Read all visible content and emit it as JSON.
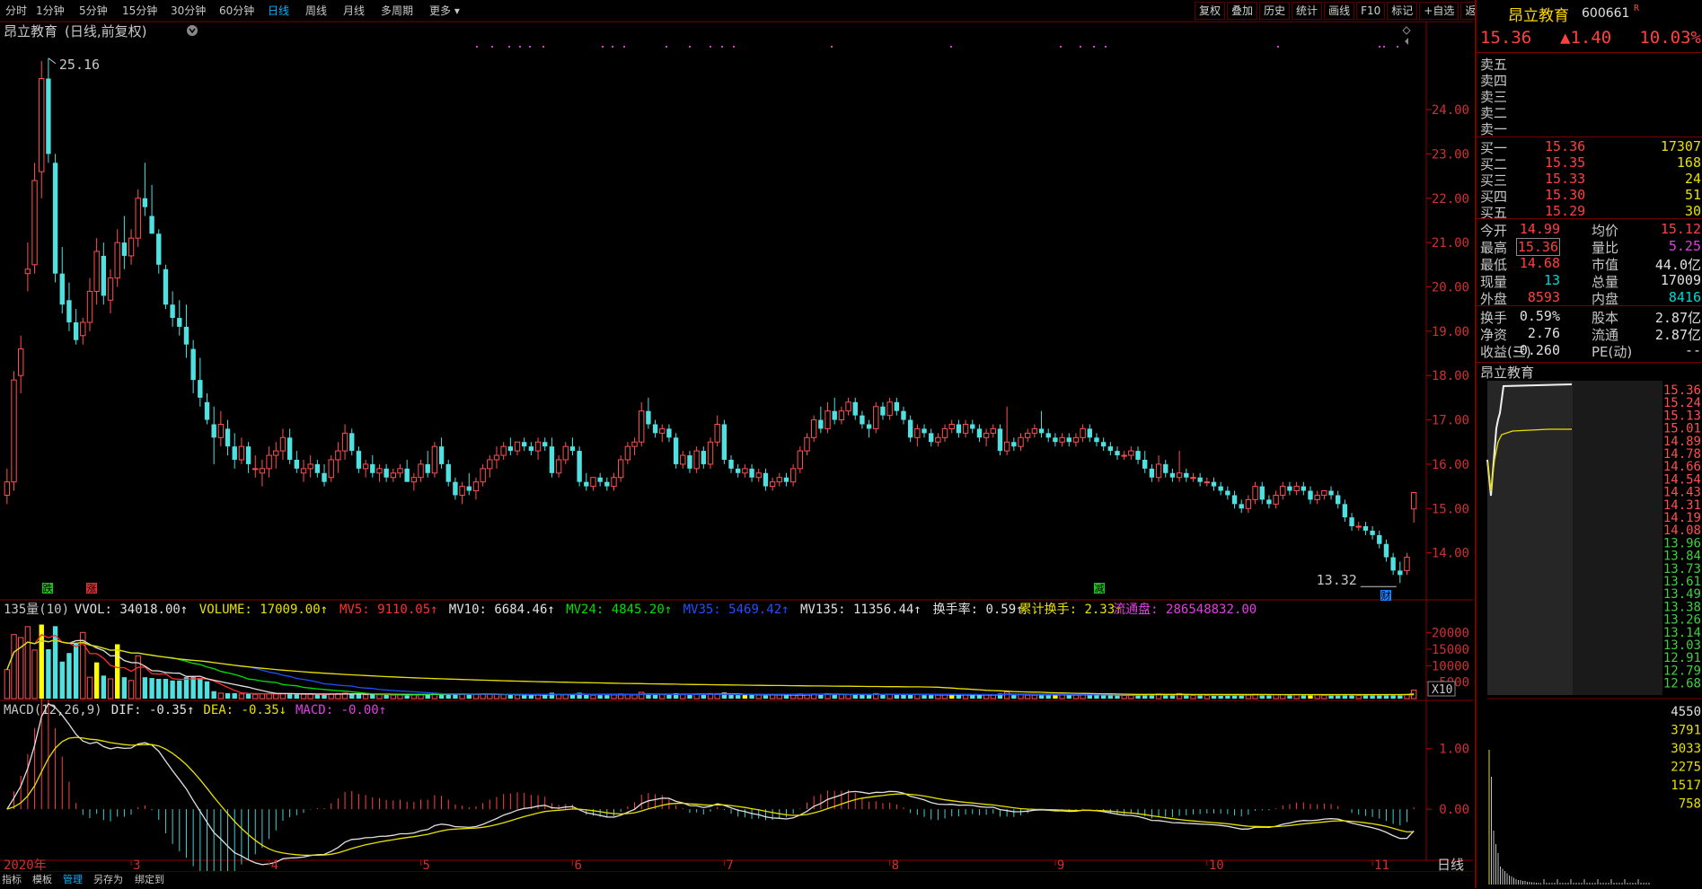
{
  "toolbar": {
    "periods": [
      "分时",
      "1分钟",
      "5分钟",
      "15分钟",
      "30分钟",
      "60分钟",
      "日线",
      "周线",
      "月线",
      "多周期",
      "更多"
    ],
    "active_period": "日线",
    "right_tools": [
      "复权",
      "叠加",
      "历史",
      "统计",
      "画线",
      "F10",
      "标记",
      "+自选",
      "返回"
    ]
  },
  "chart_header": {
    "title": "昂立教育",
    "subtitle": "(日线,前复权)",
    "high_label": "25.16",
    "low_label": "13.32",
    "markers": {
      "die": "跌",
      "zhang": "涨",
      "jian": "减",
      "cai": "财"
    }
  },
  "price_axis": {
    "labels": [
      "24.00",
      "23.00",
      "22.00",
      "21.00",
      "20.00",
      "19.00",
      "18.00",
      "17.00",
      "16.00",
      "15.00",
      "14.00"
    ]
  },
  "volume_header": {
    "items": [
      {
        "text": "135量(10)",
        "color": "#c8c8c8"
      },
      {
        "text": "VVOL: 34018.00↑",
        "color": "#e0e0e0"
      },
      {
        "text": "VOLUME: 17009.00↑",
        "color": "#e8e000"
      },
      {
        "text": "MV5: 9110.05↑",
        "color": "#ff3030"
      },
      {
        "text": "MV10: 6684.46↑",
        "color": "#e0e0e0"
      },
      {
        "text": "MV24: 4845.20↑",
        "color": "#00e000"
      },
      {
        "text": "MV35: 5469.42↑",
        "color": "#2050ff"
      },
      {
        "text": "MV135: 11356.44↑",
        "color": "#e0e0e0"
      },
      {
        "text": "换手率: 0.59↑",
        "color": "#e0e0e0"
      },
      {
        "text": "累计换手: 2.33↑",
        "color": "#e8e000"
      },
      {
        "text": "流通盘: 286548832.00",
        "color": "#e040e0"
      }
    ],
    "axis_labels": [
      "20000",
      "15000",
      "10000",
      "5000"
    ],
    "multiplier": "X10"
  },
  "macd_header": {
    "items": [
      {
        "text": "MACD(12,26,9)",
        "color": "#c8c8c8"
      },
      {
        "text": "DIF: -0.35↑",
        "color": "#e0e0e0"
      },
      {
        "text": "DEA: -0.35↓",
        "color": "#e8e000"
      },
      {
        "text": "MACD: -0.00↑",
        "color": "#e040e0"
      }
    ],
    "axis_labels": [
      "1.00",
      "0.00"
    ]
  },
  "time_axis": {
    "labels": [
      "2020年",
      "3",
      "4",
      "5",
      "6",
      "7",
      "8",
      "9",
      "10",
      "11"
    ],
    "period_label": "日线"
  },
  "bottom_tabs": {
    "items": [
      "指标",
      "模板",
      "管理",
      "另存为",
      "绑定到"
    ],
    "active": "管理"
  },
  "quote": {
    "name": "昂立教育",
    "code": "600661",
    "badge": "R",
    "price": "15.36",
    "change": "▲1.40",
    "change_pct": "10.03%",
    "sell_levels": [
      "卖五",
      "卖四",
      "卖三",
      "卖二",
      "卖一"
    ],
    "buy_levels": [
      {
        "label": "买一",
        "price": "15.36",
        "vol": "17307"
      },
      {
        "label": "买二",
        "price": "15.35",
        "vol": "168"
      },
      {
        "label": "买三",
        "price": "15.33",
        "vol": "24"
      },
      {
        "label": "买四",
        "price": "15.30",
        "vol": "51"
      },
      {
        "label": "买五",
        "price": "15.29",
        "vol": "30"
      }
    ],
    "stats": [
      {
        "l1": "今开",
        "v1": "14.99",
        "c1": "red",
        "l2": "均价",
        "v2": "15.12",
        "c2": "red"
      },
      {
        "l1": "最高",
        "v1": "15.36",
        "c1": "red",
        "l2": "量比",
        "v2": "5.25",
        "c2": "magenta"
      },
      {
        "l1": "最低",
        "v1": "14.68",
        "c1": "red",
        "l2": "市值",
        "v2": "44.0亿",
        "c2": "white"
      },
      {
        "l1": "现量",
        "v1": "13",
        "c1": "cyan",
        "l2": "总量",
        "v2": "17009",
        "c2": "white"
      },
      {
        "l1": "外盘",
        "v1": "8593",
        "c1": "red",
        "l2": "内盘",
        "v2": "8416",
        "c2": "cyan"
      }
    ],
    "stats2": [
      {
        "l1": "换手",
        "v1": "0.59%",
        "l2": "股本",
        "v2": "2.87亿"
      },
      {
        "l1": "净资",
        "v1": "2.76",
        "l2": "流通",
        "v2": "2.87亿"
      },
      {
        "l1": "收益(三)",
        "v1": "-0.260",
        "l2": "PE(动)",
        "v2": "--"
      }
    ],
    "mini_title": "昂立教育",
    "mini_price_labels": [
      "15.36",
      "15.24",
      "15.13",
      "15.01",
      "14.89",
      "14.78",
      "14.66",
      "14.54",
      "14.43",
      "14.31",
      "14.19",
      "14.08",
      "13.96",
      "13.84",
      "13.73",
      "13.61",
      "13.49",
      "13.38",
      "13.26",
      "13.14",
      "13.03",
      "12.91",
      "12.79",
      "12.68"
    ],
    "mini_vol_labels": [
      "4550",
      "3791",
      "3033",
      "2275",
      "1517",
      "758"
    ]
  },
  "chart_data": {
    "type": "candlestick",
    "title": "昂立教育",
    "x_start": "2020年",
    "month_labels": [
      "3",
      "4",
      "5",
      "6",
      "7",
      "8",
      "9",
      "10",
      "11"
    ],
    "ylim": [
      13.0,
      25.5
    ],
    "ohlc": [
      [
        15.3,
        15.9,
        15.1,
        15.6
      ],
      [
        15.6,
        18.1,
        15.4,
        17.9
      ],
      [
        18.0,
        18.9,
        17.6,
        18.6
      ],
      [
        20.3,
        21.0,
        19.9,
        20.4
      ],
      [
        20.5,
        22.8,
        20.3,
        22.4
      ],
      [
        22.6,
        25.1,
        22.0,
        24.7
      ],
      [
        24.7,
        25.16,
        22.8,
        23.0
      ],
      [
        22.8,
        23.0,
        20.1,
        20.3
      ],
      [
        20.3,
        20.9,
        19.4,
        19.6
      ],
      [
        19.7,
        20.1,
        19.0,
        19.2
      ],
      [
        19.2,
        19.5,
        18.7,
        18.8
      ],
      [
        18.9,
        19.3,
        18.7,
        19.2
      ],
      [
        19.2,
        20.2,
        19.0,
        19.9
      ],
      [
        19.9,
        21.1,
        19.6,
        20.8
      ],
      [
        20.7,
        21.0,
        19.6,
        19.8
      ],
      [
        19.7,
        20.4,
        19.4,
        20.2
      ],
      [
        20.2,
        21.3,
        20.0,
        21.0
      ],
      [
        21.0,
        21.6,
        20.4,
        20.7
      ],
      [
        20.7,
        21.3,
        20.5,
        21.1
      ],
      [
        21.1,
        22.2,
        20.9,
        22.0
      ],
      [
        22.0,
        22.8,
        21.6,
        21.8
      ],
      [
        21.6,
        22.3,
        21.2,
        21.2
      ],
      [
        21.2,
        21.3,
        20.3,
        20.5
      ],
      [
        20.4,
        20.5,
        19.5,
        19.6
      ],
      [
        19.6,
        19.9,
        19.1,
        19.3
      ],
      [
        19.3,
        19.7,
        18.9,
        19.1
      ],
      [
        19.1,
        19.6,
        18.4,
        18.7
      ],
      [
        18.6,
        18.8,
        17.6,
        17.9
      ],
      [
        17.9,
        18.4,
        17.3,
        17.5
      ],
      [
        17.4,
        17.6,
        16.9,
        17.0
      ],
      [
        16.9,
        17.3,
        16.0,
        16.6
      ],
      [
        16.6,
        17.2,
        16.4,
        16.9
      ],
      [
        16.8,
        17.0,
        16.2,
        16.4
      ],
      [
        16.4,
        16.7,
        15.9,
        16.1
      ],
      [
        16.1,
        16.6,
        16.0,
        16.4
      ],
      [
        16.4,
        16.5,
        15.8,
        16.0
      ],
      [
        15.9,
        16.2,
        15.7,
        15.9
      ],
      [
        15.8,
        16.1,
        15.5,
        15.9
      ],
      [
        15.9,
        16.4,
        15.7,
        16.2
      ],
      [
        16.2,
        16.5,
        15.9,
        16.3
      ],
      [
        16.3,
        16.8,
        16.1,
        16.6
      ],
      [
        16.6,
        16.8,
        16.0,
        16.1
      ],
      [
        16.1,
        16.3,
        15.8,
        15.9
      ],
      [
        15.8,
        16.1,
        15.6,
        15.9
      ],
      [
        15.9,
        16.2,
        15.7,
        16.0
      ],
      [
        16.0,
        16.1,
        15.7,
        15.8
      ],
      [
        15.8,
        16.0,
        15.5,
        15.6
      ],
      [
        15.7,
        16.2,
        15.6,
        16.1
      ],
      [
        16.1,
        16.5,
        15.8,
        16.3
      ],
      [
        16.3,
        16.9,
        16.1,
        16.7
      ],
      [
        16.7,
        16.8,
        16.2,
        16.3
      ],
      [
        16.3,
        16.4,
        15.8,
        15.9
      ],
      [
        15.9,
        16.1,
        15.7,
        16.0
      ],
      [
        16.0,
        16.2,
        15.7,
        15.8
      ],
      [
        15.8,
        16.0,
        15.6,
        15.9
      ],
      [
        15.9,
        16.0,
        15.6,
        15.7
      ],
      [
        15.7,
        15.9,
        15.6,
        15.8
      ],
      [
        15.8,
        16.0,
        15.7,
        15.9
      ],
      [
        15.9,
        16.1,
        15.6,
        15.6
      ],
      [
        15.6,
        15.8,
        15.4,
        15.7
      ],
      [
        15.7,
        16.1,
        15.6,
        16.0
      ],
      [
        16.0,
        16.3,
        15.7,
        15.8
      ],
      [
        15.8,
        16.5,
        15.7,
        16.4
      ],
      [
        16.4,
        16.6,
        15.9,
        16.0
      ],
      [
        16.0,
        16.1,
        15.5,
        15.6
      ],
      [
        15.6,
        15.7,
        15.2,
        15.3
      ],
      [
        15.3,
        15.6,
        15.1,
        15.5
      ],
      [
        15.5,
        15.8,
        15.3,
        15.4
      ],
      [
        15.4,
        15.7,
        15.2,
        15.6
      ],
      [
        15.6,
        16.0,
        15.5,
        15.9
      ],
      [
        15.9,
        16.2,
        15.7,
        16.1
      ],
      [
        16.1,
        16.4,
        15.9,
        16.2
      ],
      [
        16.2,
        16.5,
        16.1,
        16.4
      ],
      [
        16.4,
        16.6,
        16.2,
        16.3
      ],
      [
        16.3,
        16.5,
        16.2,
        16.5
      ],
      [
        16.5,
        16.6,
        16.3,
        16.4
      ],
      [
        16.4,
        16.5,
        16.2,
        16.3
      ],
      [
        16.3,
        16.6,
        16.1,
        16.5
      ],
      [
        16.5,
        16.6,
        16.3,
        16.4
      ],
      [
        16.4,
        16.6,
        15.7,
        15.8
      ],
      [
        15.8,
        16.2,
        15.7,
        16.1
      ],
      [
        16.1,
        16.5,
        16.0,
        16.4
      ],
      [
        16.4,
        16.6,
        16.2,
        16.3
      ],
      [
        16.3,
        16.4,
        15.5,
        15.6
      ],
      [
        15.6,
        15.8,
        15.4,
        15.5
      ],
      [
        15.5,
        15.7,
        15.4,
        15.7
      ],
      [
        15.7,
        15.8,
        15.5,
        15.6
      ],
      [
        15.6,
        15.7,
        15.4,
        15.5
      ],
      [
        15.5,
        15.8,
        15.4,
        15.7
      ],
      [
        15.7,
        16.2,
        15.6,
        16.1
      ],
      [
        16.1,
        16.5,
        16.0,
        16.4
      ],
      [
        16.4,
        16.6,
        16.2,
        16.5
      ],
      [
        16.5,
        17.4,
        16.4,
        17.2
      ],
      [
        17.2,
        17.5,
        16.8,
        16.9
      ],
      [
        16.9,
        17.0,
        16.6,
        16.7
      ],
      [
        16.7,
        16.9,
        16.5,
        16.8
      ],
      [
        16.8,
        16.9,
        16.5,
        16.6
      ],
      [
        16.6,
        16.7,
        15.9,
        16.0
      ],
      [
        16.0,
        16.3,
        15.9,
        16.2
      ],
      [
        16.2,
        16.3,
        15.8,
        15.9
      ],
      [
        15.9,
        16.4,
        15.8,
        16.3
      ],
      [
        16.3,
        16.4,
        15.9,
        16.0
      ],
      [
        16.0,
        16.6,
        15.9,
        16.5
      ],
      [
        16.5,
        17.1,
        16.4,
        16.9
      ],
      [
        16.9,
        17.0,
        16.0,
        16.1
      ],
      [
        16.1,
        16.2,
        15.8,
        15.9
      ],
      [
        15.9,
        16.0,
        15.7,
        15.8
      ],
      [
        15.8,
        16.0,
        15.7,
        15.9
      ],
      [
        15.9,
        16.0,
        15.6,
        15.7
      ],
      [
        15.7,
        15.9,
        15.6,
        15.8
      ],
      [
        15.8,
        15.9,
        15.4,
        15.5
      ],
      [
        15.5,
        15.7,
        15.4,
        15.6
      ],
      [
        15.6,
        15.8,
        15.5,
        15.7
      ],
      [
        15.7,
        15.8,
        15.5,
        15.6
      ],
      [
        15.6,
        16.0,
        15.5,
        15.9
      ],
      [
        15.9,
        16.4,
        15.8,
        16.3
      ],
      [
        16.3,
        16.7,
        16.2,
        16.6
      ],
      [
        16.6,
        17.1,
        16.5,
        17.0
      ],
      [
        17.0,
        17.3,
        16.7,
        16.8
      ],
      [
        16.8,
        17.4,
        16.7,
        17.2
      ],
      [
        17.2,
        17.5,
        16.9,
        17.0
      ],
      [
        17.0,
        17.3,
        16.9,
        17.2
      ],
      [
        17.2,
        17.5,
        17.1,
        17.4
      ],
      [
        17.4,
        17.5,
        17.0,
        17.1
      ],
      [
        17.1,
        17.2,
        16.8,
        16.9
      ],
      [
        16.9,
        17.0,
        16.6,
        16.8
      ],
      [
        16.8,
        17.4,
        16.7,
        17.3
      ],
      [
        17.3,
        17.4,
        17.0,
        17.1
      ],
      [
        17.1,
        17.5,
        17.0,
        17.4
      ],
      [
        17.4,
        17.5,
        17.1,
        17.2
      ],
      [
        17.2,
        17.3,
        16.9,
        17.0
      ],
      [
        17.0,
        17.1,
        16.5,
        16.6
      ],
      [
        16.6,
        16.9,
        16.4,
        16.8
      ],
      [
        16.8,
        16.9,
        16.6,
        16.7
      ],
      [
        16.7,
        16.8,
        16.4,
        16.5
      ],
      [
        16.5,
        16.7,
        16.4,
        16.6
      ],
      [
        16.6,
        16.9,
        16.5,
        16.8
      ],
      [
        16.8,
        17.0,
        16.7,
        16.9
      ],
      [
        16.9,
        17.0,
        16.6,
        16.7
      ],
      [
        16.7,
        17.0,
        16.6,
        16.9
      ],
      [
        16.9,
        17.0,
        16.7,
        16.8
      ],
      [
        16.8,
        16.9,
        16.5,
        16.6
      ],
      [
        16.6,
        16.8,
        16.4,
        16.7
      ],
      [
        16.7,
        16.9,
        16.6,
        16.8
      ],
      [
        16.8,
        16.9,
        16.2,
        16.3
      ],
      [
        16.3,
        17.3,
        16.2,
        16.5
      ],
      [
        16.5,
        16.6,
        16.3,
        16.4
      ],
      [
        16.4,
        16.7,
        16.3,
        16.6
      ],
      [
        16.6,
        16.8,
        16.5,
        16.7
      ],
      [
        16.7,
        16.9,
        16.6,
        16.8
      ],
      [
        16.8,
        17.2,
        16.6,
        16.7
      ],
      [
        16.7,
        16.8,
        16.5,
        16.6
      ],
      [
        16.6,
        16.7,
        16.4,
        16.5
      ],
      [
        16.5,
        16.7,
        16.4,
        16.6
      ],
      [
        16.6,
        16.7,
        16.4,
        16.5
      ],
      [
        16.5,
        16.7,
        16.4,
        16.6
      ],
      [
        16.6,
        16.9,
        16.5,
        16.8
      ],
      [
        16.8,
        16.9,
        16.5,
        16.6
      ],
      [
        16.6,
        16.7,
        16.4,
        16.5
      ],
      [
        16.5,
        16.6,
        16.3,
        16.4
      ],
      [
        16.4,
        16.5,
        16.2,
        16.3
      ],
      [
        16.3,
        16.4,
        16.1,
        16.2
      ],
      [
        16.2,
        16.3,
        16.1,
        16.2
      ],
      [
        16.2,
        16.4,
        16.1,
        16.3
      ],
      [
        16.3,
        16.4,
        16.0,
        16.1
      ],
      [
        16.1,
        16.3,
        15.8,
        15.9
      ],
      [
        15.9,
        16.0,
        15.6,
        15.7
      ],
      [
        15.7,
        16.2,
        15.6,
        16.0
      ],
      [
        16.0,
        16.1,
        15.7,
        15.8
      ],
      [
        15.8,
        15.9,
        15.6,
        15.7
      ],
      [
        15.7,
        16.3,
        15.6,
        15.8
      ],
      [
        15.8,
        15.9,
        15.6,
        15.7
      ],
      [
        15.7,
        15.8,
        15.6,
        15.7
      ],
      [
        15.7,
        15.8,
        15.5,
        15.6
      ],
      [
        15.6,
        15.7,
        15.5,
        15.6
      ],
      [
        15.6,
        15.7,
        15.4,
        15.5
      ],
      [
        15.5,
        15.6,
        15.3,
        15.4
      ],
      [
        15.4,
        15.5,
        15.2,
        15.3
      ],
      [
        15.3,
        15.4,
        15.0,
        15.1
      ],
      [
        15.1,
        15.2,
        14.9,
        15.0
      ],
      [
        15.0,
        15.3,
        14.9,
        15.2
      ],
      [
        15.2,
        15.6,
        15.1,
        15.5
      ],
      [
        15.5,
        15.6,
        15.1,
        15.2
      ],
      [
        15.2,
        15.3,
        15.0,
        15.1
      ],
      [
        15.1,
        15.4,
        15.0,
        15.3
      ],
      [
        15.3,
        15.6,
        15.2,
        15.5
      ],
      [
        15.5,
        15.6,
        15.3,
        15.4
      ],
      [
        15.4,
        15.6,
        15.3,
        15.5
      ],
      [
        15.5,
        15.6,
        15.3,
        15.4
      ],
      [
        15.4,
        15.5,
        15.1,
        15.2
      ],
      [
        15.2,
        15.4,
        15.1,
        15.3
      ],
      [
        15.3,
        15.4,
        15.2,
        15.4
      ],
      [
        15.4,
        15.5,
        15.2,
        15.3
      ],
      [
        15.3,
        15.4,
        15.0,
        15.1
      ],
      [
        15.1,
        15.2,
        14.7,
        14.8
      ],
      [
        14.8,
        14.9,
        14.5,
        14.6
      ],
      [
        14.6,
        14.7,
        14.5,
        14.6
      ],
      [
        14.6,
        14.7,
        14.4,
        14.5
      ],
      [
        14.5,
        14.6,
        14.3,
        14.4
      ],
      [
        14.4,
        14.5,
        14.1,
        14.2
      ],
      [
        14.2,
        14.3,
        13.8,
        13.9
      ],
      [
        13.9,
        14.0,
        13.5,
        13.6
      ],
      [
        13.6,
        13.8,
        13.32,
        13.5
      ],
      [
        13.6,
        14.0,
        13.5,
        13.9
      ],
      [
        14.99,
        15.36,
        14.68,
        15.36
      ]
    ]
  }
}
